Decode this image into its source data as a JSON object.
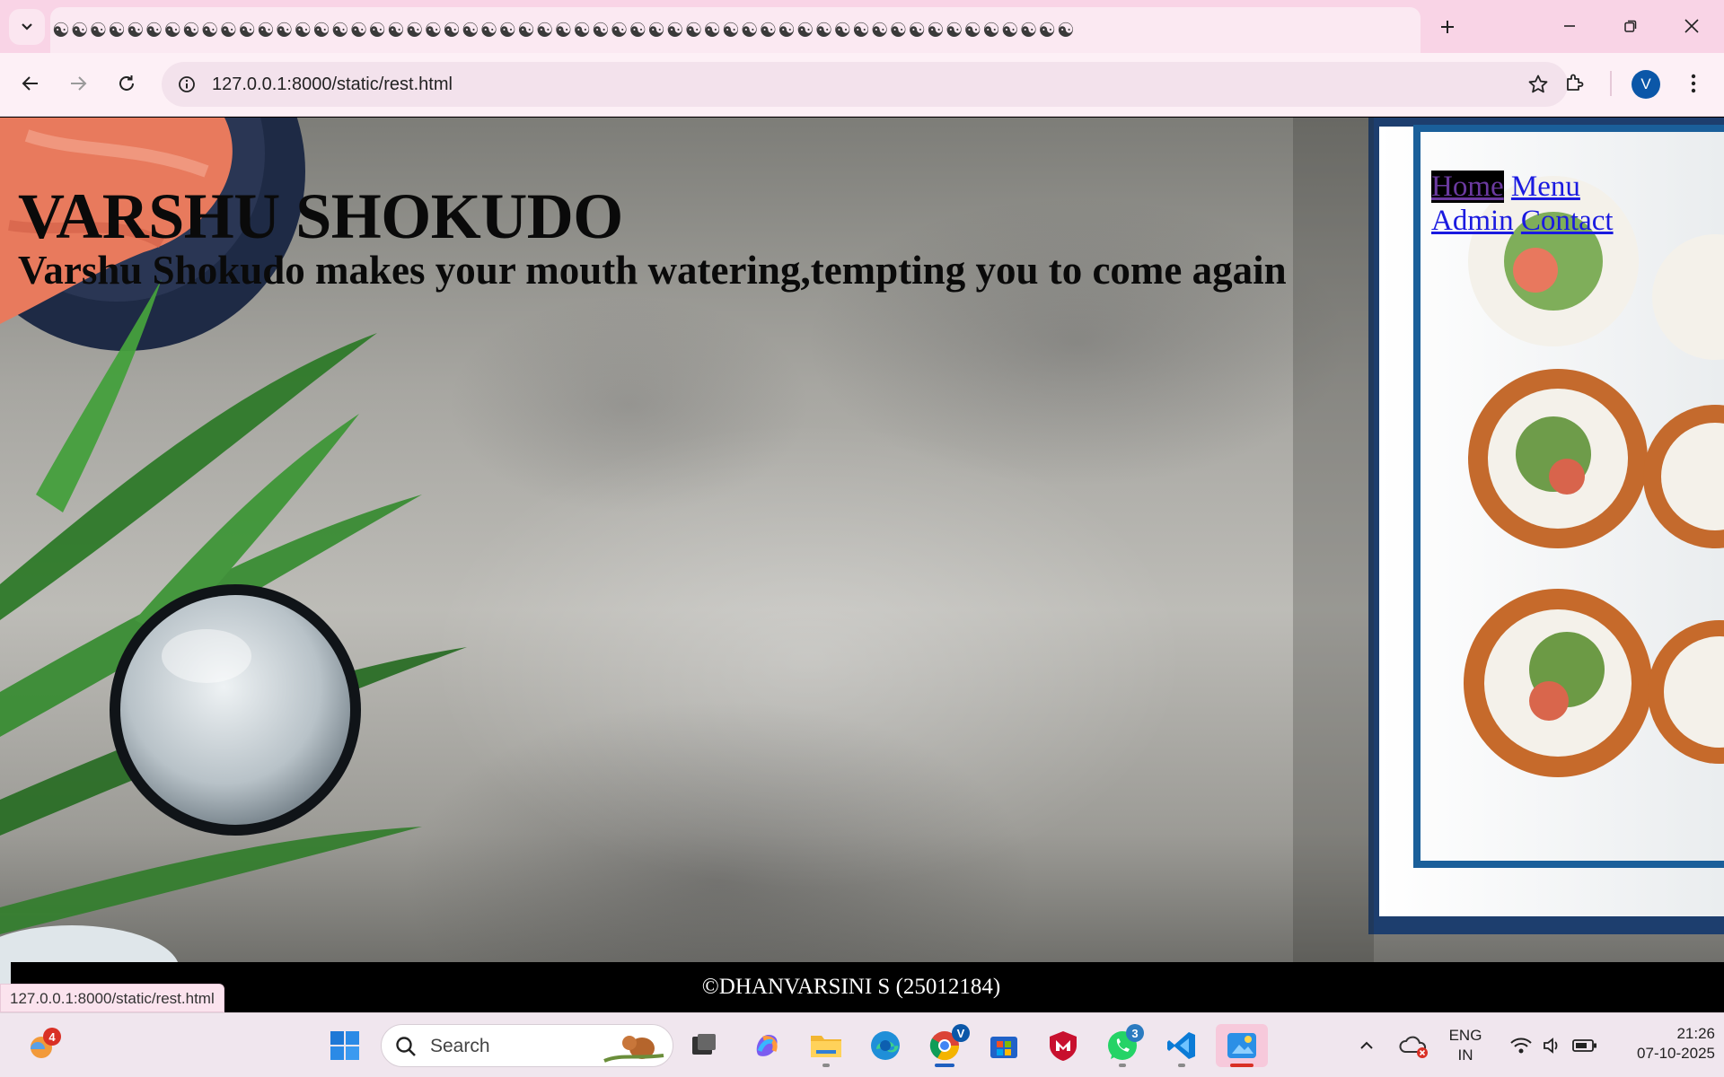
{
  "browser": {
    "tab_title": "☯☯☯☯☯☯☯☯☯☯☯☯☯☯☯☯☯☯☯☯☯☯☯☯☯☯☯☯☯☯☯☯☯☯☯☯☯☯☯☯☯☯☯☯☯☯☯☯☯☯☯☯☯☯☯",
    "url": "127.0.0.1:8000/static/rest.html",
    "profile_initial": "V",
    "status_url": "127.0.0.1:8000/static/rest.html"
  },
  "page": {
    "title": "VARSHU SHOKUDO",
    "tagline": "Varshu Shokudo makes your mouth watering,tempting you to come again",
    "nav": [
      {
        "label": "Home",
        "active": true
      },
      {
        "label": "Menu",
        "active": false
      },
      {
        "label": "Admin",
        "active": false
      },
      {
        "label": "Contact",
        "active": false
      }
    ],
    "footer": "©DHANVARSINI S (25012184)"
  },
  "taskbar": {
    "search_placeholder": "Search",
    "weather_badge": "4",
    "whatsapp_badge": "3",
    "chrome_profile": "V",
    "language_line1": "ENG",
    "language_line2": "IN",
    "time": "21:26",
    "date": "07-10-2025"
  },
  "colors": {
    "tab_strip": "#f9d4e6",
    "toolbar": "#fdf0f6",
    "link": "#1a1ae0",
    "footer_bg": "#000000",
    "accent_blue": "#0b57a8"
  }
}
